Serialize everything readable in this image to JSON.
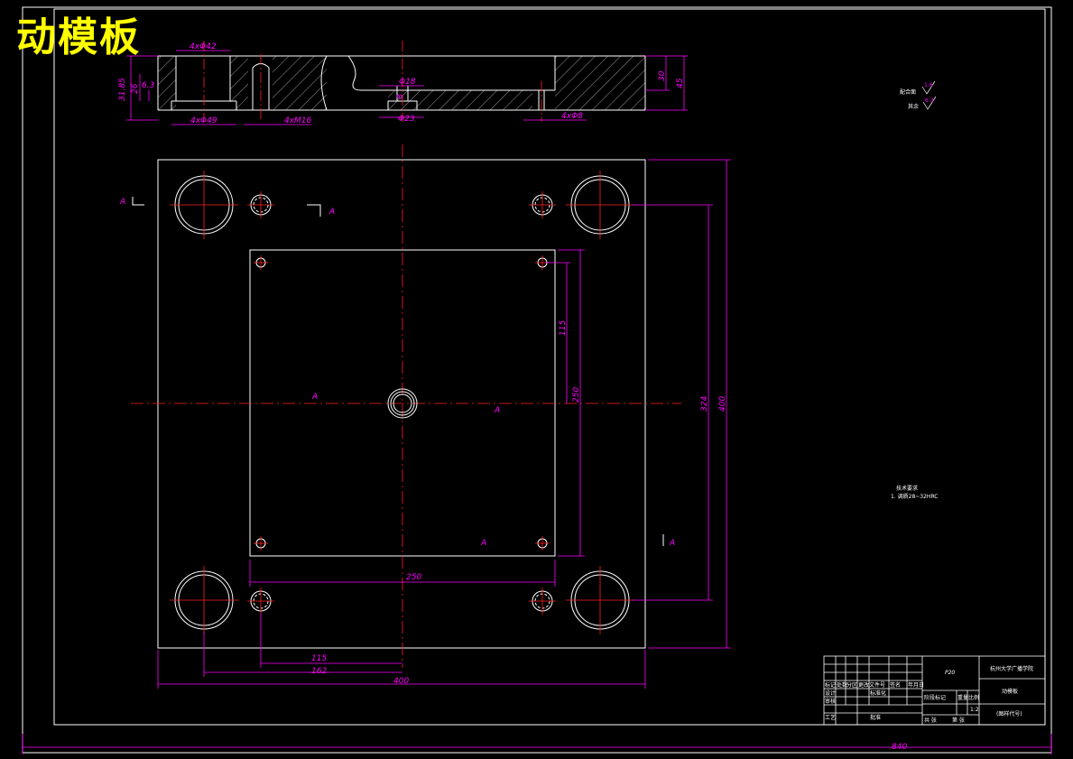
{
  "title": "动模板",
  "section": {
    "dims": {
      "d1": "4xΦ42",
      "d2": "4xΦ49",
      "d3": "4xM16",
      "d4": "Φ18",
      "d5": "Φ23",
      "d6": "4xΦ8",
      "d7": "30",
      "d8": "45",
      "d9": "31.85",
      "d10": "26",
      "d11": "6.3",
      "d12": "8"
    }
  },
  "plan": {
    "dims": {
      "h250": "250",
      "h115": "115",
      "h162": "162",
      "h400": "400",
      "v115": "115",
      "v250": "250",
      "v324": "324",
      "v400": "400",
      "sheet": "840"
    },
    "section_marks": [
      "A",
      "A",
      "A",
      "A",
      "A",
      "A"
    ]
  },
  "roughness": {
    "line1": "配合面",
    "line2": "其余",
    "v1": "1.6",
    "v2": "6.3"
  },
  "notes": {
    "heading": "技术要求",
    "line1": "1. 调质28~32HRC"
  },
  "title_block": {
    "material": "P20",
    "company": "杭州大学广播学院",
    "part_name": "动模板",
    "drawing_no": "(图样代号)",
    "scale": "1:2",
    "labels": [
      "标记",
      "处数",
      "分区",
      "更改文件号",
      "签名",
      "年月日",
      "设计",
      "标准化",
      "审核",
      "工艺",
      "批准",
      "阶段标记",
      "重量",
      "比例",
      "共 张",
      "第 张"
    ]
  }
}
